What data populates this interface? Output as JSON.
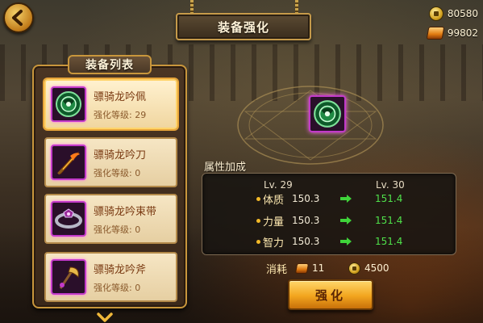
{
  "header": {
    "title": "装备强化",
    "back_icon": "back-arrow-icon"
  },
  "currency": {
    "coins": "80580",
    "ingots": "99802",
    "coin_icon": "gold-coin-icon",
    "ingot_icon": "gold-ingot-icon"
  },
  "equipment_list": {
    "title": "装备列表",
    "items": [
      {
        "name": "骠骑龙吟佩",
        "level_label": "强化等级:",
        "level": "29",
        "selected": true,
        "icon": "jade-pendant-icon"
      },
      {
        "name": "骠骑龙吟刀",
        "level_label": "强化等级:",
        "level": "0",
        "selected": false,
        "icon": "flame-blade-icon"
      },
      {
        "name": "骠骑龙吟束带",
        "level_label": "强化等级:",
        "level": "0",
        "selected": false,
        "icon": "belt-icon"
      },
      {
        "name": "骠骑龙吟斧",
        "level_label": "强化等级:",
        "level": "0",
        "selected": false,
        "icon": "axe-icon"
      }
    ],
    "scroll_icon": "chevron-down-icon"
  },
  "attributes": {
    "title": "属性加成",
    "current_level": "Lv. 29",
    "next_level": "Lv. 30",
    "stats": [
      {
        "name": "体质",
        "current": "150.3",
        "next": "151.4"
      },
      {
        "name": "力量",
        "current": "150.3",
        "next": "151.4"
      },
      {
        "name": "智力",
        "current": "150.3",
        "next": "151.4"
      }
    ],
    "arrow_color": "#3fd43a",
    "increase_color": "#4fe04a"
  },
  "cost": {
    "label": "消耗",
    "ingots": "11",
    "coins": "4500"
  },
  "actions": {
    "enhance_label": "强化"
  },
  "colors": {
    "panel_border": "#c8963c",
    "item_name": "#7a3a12",
    "rare_frame": "#c23ac9",
    "button": "#f2a51e"
  }
}
